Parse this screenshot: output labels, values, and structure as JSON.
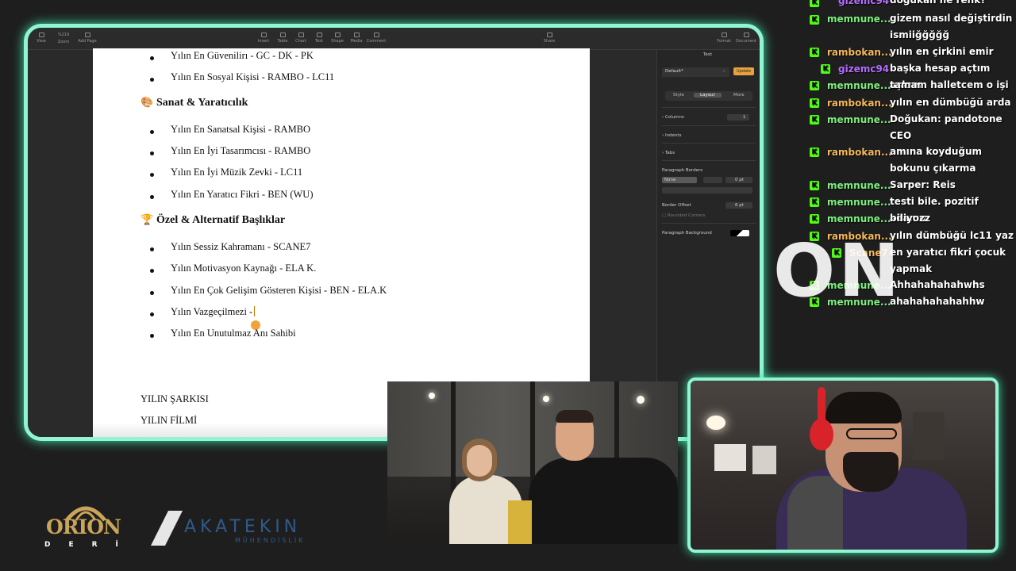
{
  "toolbar": {
    "items": [
      {
        "label": "View"
      },
      {
        "label": "Zoom",
        "value": "%219"
      },
      {
        "label": "Add Page"
      },
      {
        "label": "Insert"
      },
      {
        "label": "Table"
      },
      {
        "label": "Chart"
      },
      {
        "label": "Text"
      },
      {
        "label": "Shape"
      },
      {
        "label": "Media"
      },
      {
        "label": "Comment"
      },
      {
        "label": "Share"
      },
      {
        "label": "Format"
      },
      {
        "label": "Document"
      }
    ]
  },
  "document": {
    "lines": [
      {
        "type": "bullet",
        "text": "Yılın En Güvenilirı - GC - DK - PK"
      },
      {
        "type": "bullet",
        "text": "Yılın En Sosyal Kişisi - RAMBO - LC11"
      },
      {
        "type": "heading",
        "emoji": "🎨",
        "text": "Sanat & Yaratıcılık"
      },
      {
        "type": "bullet",
        "text": "Yılın En Sanatsal Kişisi - RAMBO"
      },
      {
        "type": "bullet",
        "text": "Yılın En İyi Tasarımcısı - RAMBO"
      },
      {
        "type": "bullet",
        "text": "Yılın En İyi Müzik Zevki - LC11"
      },
      {
        "type": "bullet",
        "text": "Yılın En Yaratıcı Fikri - BEN (WU)"
      },
      {
        "type": "heading",
        "emoji": "🏆",
        "text": "Özel & Alternatif Başlıklar"
      },
      {
        "type": "bullet",
        "text": "Yılın Sessiz Kahramanı - SCANE7"
      },
      {
        "type": "bullet",
        "text": "Yılın Motivasyon Kaynağı - ELA K."
      },
      {
        "type": "bullet",
        "text": "Yılın En Çok Gelişim Gösteren Kişisi - BEN - ELA.K"
      },
      {
        "type": "bullet",
        "text": "Yılın Vazgeçilmezi -"
      },
      {
        "type": "bullet",
        "text": "Yılın En Unutulmaz Anı Sahibi"
      },
      {
        "type": "plain",
        "text": "YILIN ŞARKISI"
      },
      {
        "type": "plain",
        "text": "YILIN FİLMİ"
      }
    ]
  },
  "inspector": {
    "panel_title": "Text",
    "style_select": "Default*",
    "update_button": "Update",
    "tabs": [
      "Style",
      "Layout",
      "More"
    ],
    "active_tab": "Layout",
    "columns_label": "Columns",
    "columns_value": "1",
    "indents_label": "Indents",
    "tabs_label": "Tabs",
    "paragraph_borders_label": "Paragraph Borders",
    "border_style": "None",
    "border_width": "0 pt",
    "border_offset_label": "Border Offset",
    "border_offset_value": "6 pt",
    "rounded_corners_label": "Rounded Corners",
    "paragraph_background_label": "Paragraph Background"
  },
  "chat": [
    {
      "user": "gizemc94",
      "color": "#b56cff",
      "text": "doğukan ne renk?"
    },
    {
      "user": "memnune...",
      "color": "#7ff07f",
      "text": "gizem nasıl değiştirdin ismiiğğğğğ"
    },
    {
      "user": "rambokan...",
      "color": "#f5b85a",
      "text": "yılın en çirkini emir"
    },
    {
      "user": "gizemc94",
      "color": "#b56cff",
      "text": "başka hesap açtım aşkım"
    },
    {
      "user": "memnune...",
      "color": "#7ff07f",
      "text": "tamam halletcem o işi"
    },
    {
      "user": "rambokan...",
      "color": "#f5b85a",
      "text": "yılın en dümbüğü arda"
    },
    {
      "user": "memnune...",
      "color": "#7ff07f",
      "text": "Doğukan: pandotone CEO"
    },
    {
      "user": "rambokan...",
      "color": "#f5b85a",
      "text": "amına koyduğum bokunu çıkarma"
    },
    {
      "user": "memnune...",
      "color": "#7ff07f",
      "text": "Sarper: Reis"
    },
    {
      "user": "memnune...",
      "color": "#7ff07f",
      "text": "testi bile. pozitif adamın"
    },
    {
      "user": "memnune...",
      "color": "#7ff07f",
      "text": "biliyozz"
    },
    {
      "user": "rambokan...",
      "color": "#f5b85a",
      "text": "yılın dümbüğü lc11 yaz"
    },
    {
      "user": "Scane7",
      "color": "#f5b85a",
      "text": "en yaratıcı fikri çocuk yapmak"
    },
    {
      "user": "memnune...",
      "color": "#7ff07f",
      "text": "Ahhahahahahwhs"
    },
    {
      "user": "memnune...",
      "color": "#7ff07f",
      "text": "ahahahahahahhw"
    }
  ],
  "overlay_text": "ON",
  "logos": {
    "orion": {
      "word": "ORION",
      "sub": "DERİ"
    },
    "akatekin": {
      "word": "AKATEKIN",
      "sub": "MÜHENDİSLİK"
    }
  },
  "colors": {
    "frame_glow": "#8ff5d2",
    "kick_green": "#53fc18",
    "update_orange": "#e8a23c"
  }
}
